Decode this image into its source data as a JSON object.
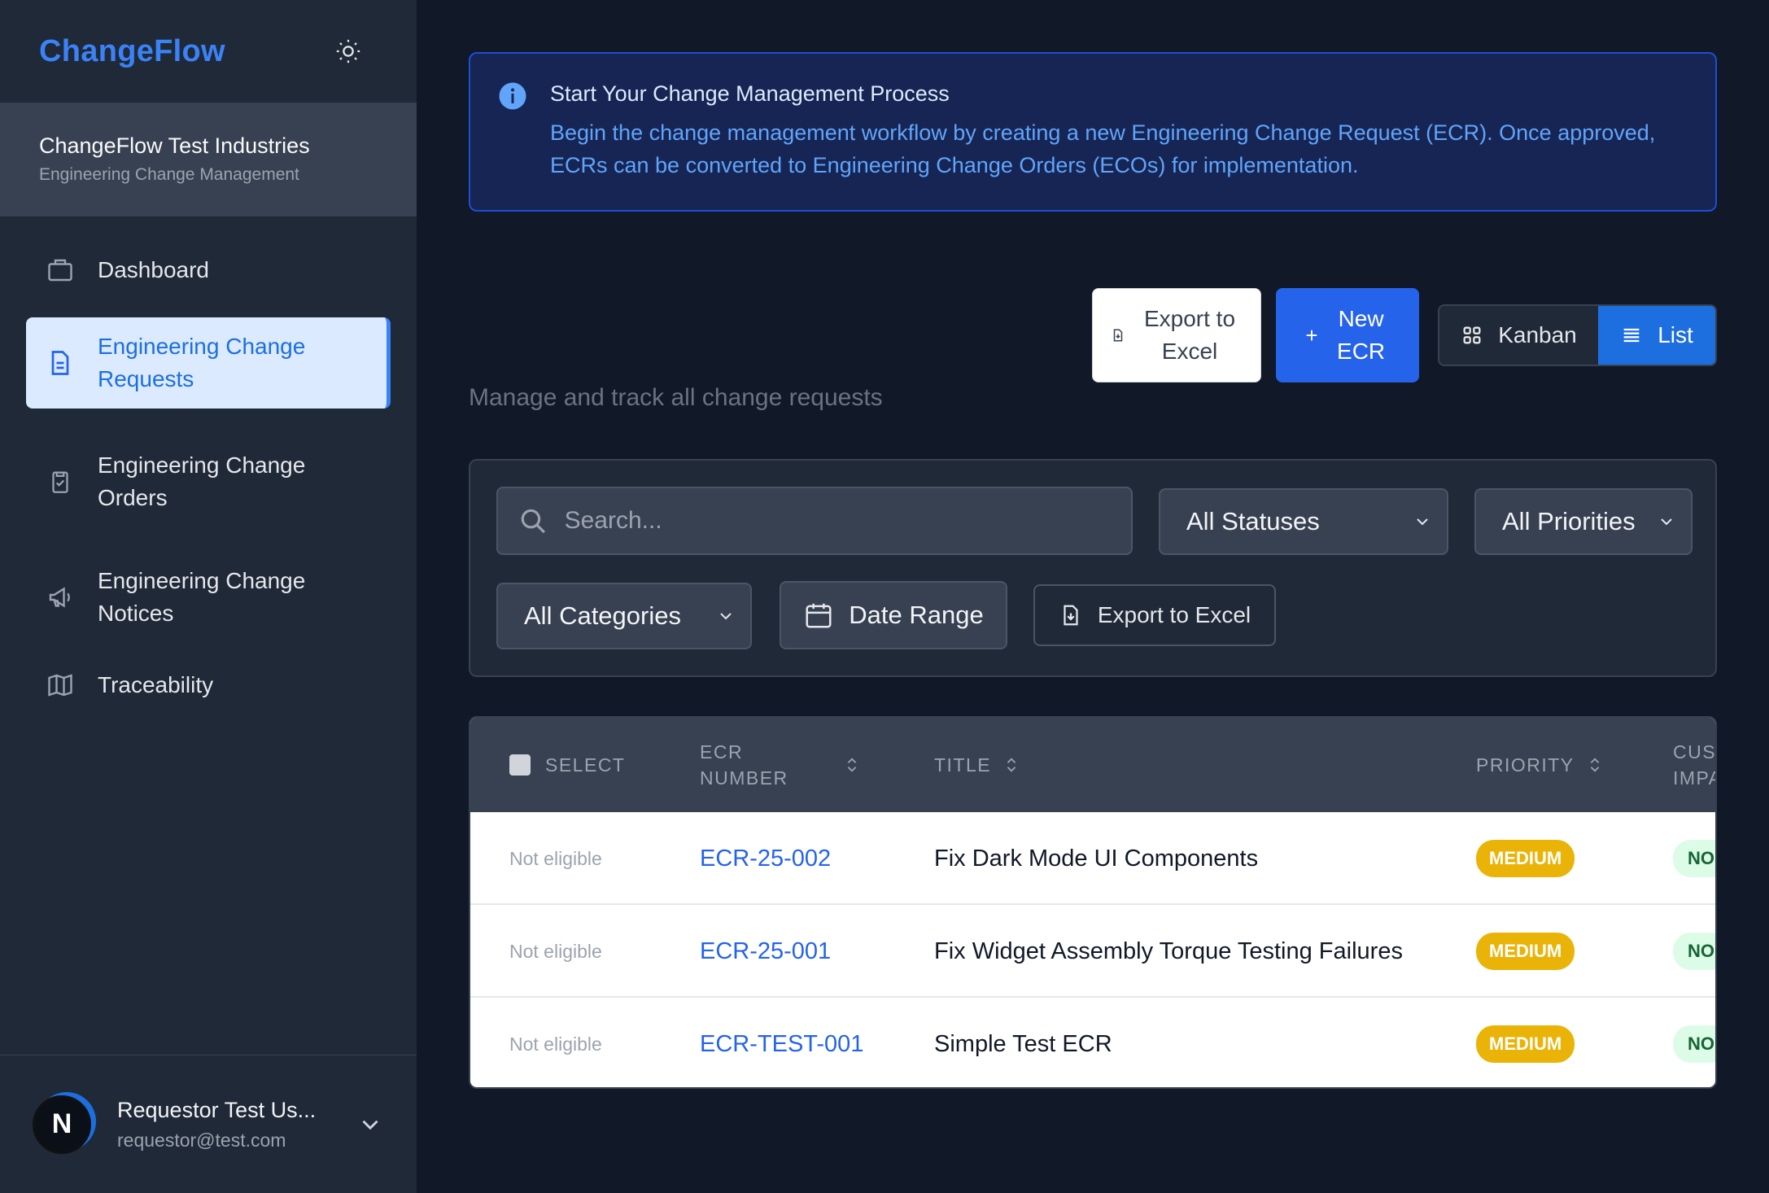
{
  "brand": {
    "name": "ChangeFlow"
  },
  "org": {
    "name": "ChangeFlow Test Industries",
    "subtitle": "Engineering Change Management"
  },
  "nav": [
    {
      "label": "Dashboard",
      "icon": "briefcase-icon"
    },
    {
      "label": "Engineering Change Requests",
      "icon": "document-icon",
      "active": true
    },
    {
      "label": "Engineering Change Orders",
      "icon": "clipboard-check-icon"
    },
    {
      "label": "Engineering Change Notices",
      "icon": "megaphone-icon"
    },
    {
      "label": "Traceability",
      "icon": "map-icon"
    }
  ],
  "user": {
    "avatar_letter": "N",
    "name": "Requestor Test Us...",
    "email": "requestor@test.com"
  },
  "banner": {
    "title": "Start Your Change Management Process",
    "text": "Begin the change management workflow by creating a new Engineering Change Request (ECR). Once approved, ECRs can be converted to Engineering Change Orders (ECOs) for implementation."
  },
  "actions": {
    "export_label": "Export to Excel",
    "new_label": "New ECR",
    "kanban_label": "Kanban",
    "list_label": "List"
  },
  "subtitle": "Manage and track all change requests",
  "filters": {
    "search_placeholder": "Search...",
    "status": "All Statuses",
    "priority": "All Priorities",
    "category": "All Categories",
    "date_range": "Date Range",
    "export_label": "Export to Excel"
  },
  "table": {
    "headers": {
      "select": "SELECT",
      "ecr_number": "ECR NUMBER",
      "title": "TITLE",
      "priority": "PRIORITY",
      "customer_impact": "CUSTOMER IMPACT"
    },
    "rows": [
      {
        "eligibility": "Not eligible",
        "number": "ECR-25-002",
        "title": "Fix Dark Mode UI Components",
        "priority": "MEDIUM",
        "customer_impact": "NO"
      },
      {
        "eligibility": "Not eligible",
        "number": "ECR-25-001",
        "title": "Fix Widget Assembly Torque Testing Failures",
        "priority": "MEDIUM",
        "customer_impact": "NO"
      },
      {
        "eligibility": "Not eligible",
        "number": "ECR-TEST-001",
        "title": "Simple Test ECR",
        "priority": "MEDIUM",
        "customer_impact": "NO"
      }
    ]
  },
  "colors": {
    "accent": "#2563eb",
    "sidebar_bg": "#1f2937",
    "page_bg": "#111827",
    "priority_medium": "#eab308"
  }
}
